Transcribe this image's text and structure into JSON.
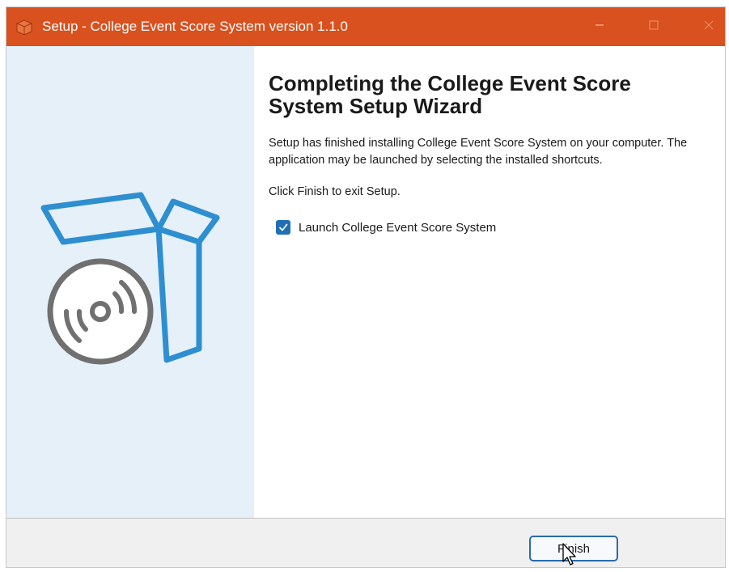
{
  "window": {
    "title": "Setup - College Event Score System version 1.1.0",
    "title_bar_color": "#d9511f",
    "icons": {
      "app": "setup-box-icon",
      "minimize": "minimize-icon",
      "maximize": "maximize-icon",
      "close": "close-icon"
    }
  },
  "side_panel": {
    "background_color": "#e6f0f9",
    "illustration": "open-box-with-disc-icon",
    "accent_color": "#2e8fd0",
    "disc_color": "#707070"
  },
  "content": {
    "heading": "Completing the College Event Score System Setup Wizard",
    "paragraph_1": "Setup has finished installing College Event Score System on your computer. The application may be launched by selecting the installed shortcuts.",
    "paragraph_2": "Click Finish to exit Setup.",
    "launch_checkbox": {
      "label": "Launch College Event Score System",
      "checked": true,
      "color": "#1f6fb5"
    }
  },
  "footer": {
    "finish_label": "Finish"
  },
  "pointer": {
    "icon": "arrow-cursor-icon"
  }
}
